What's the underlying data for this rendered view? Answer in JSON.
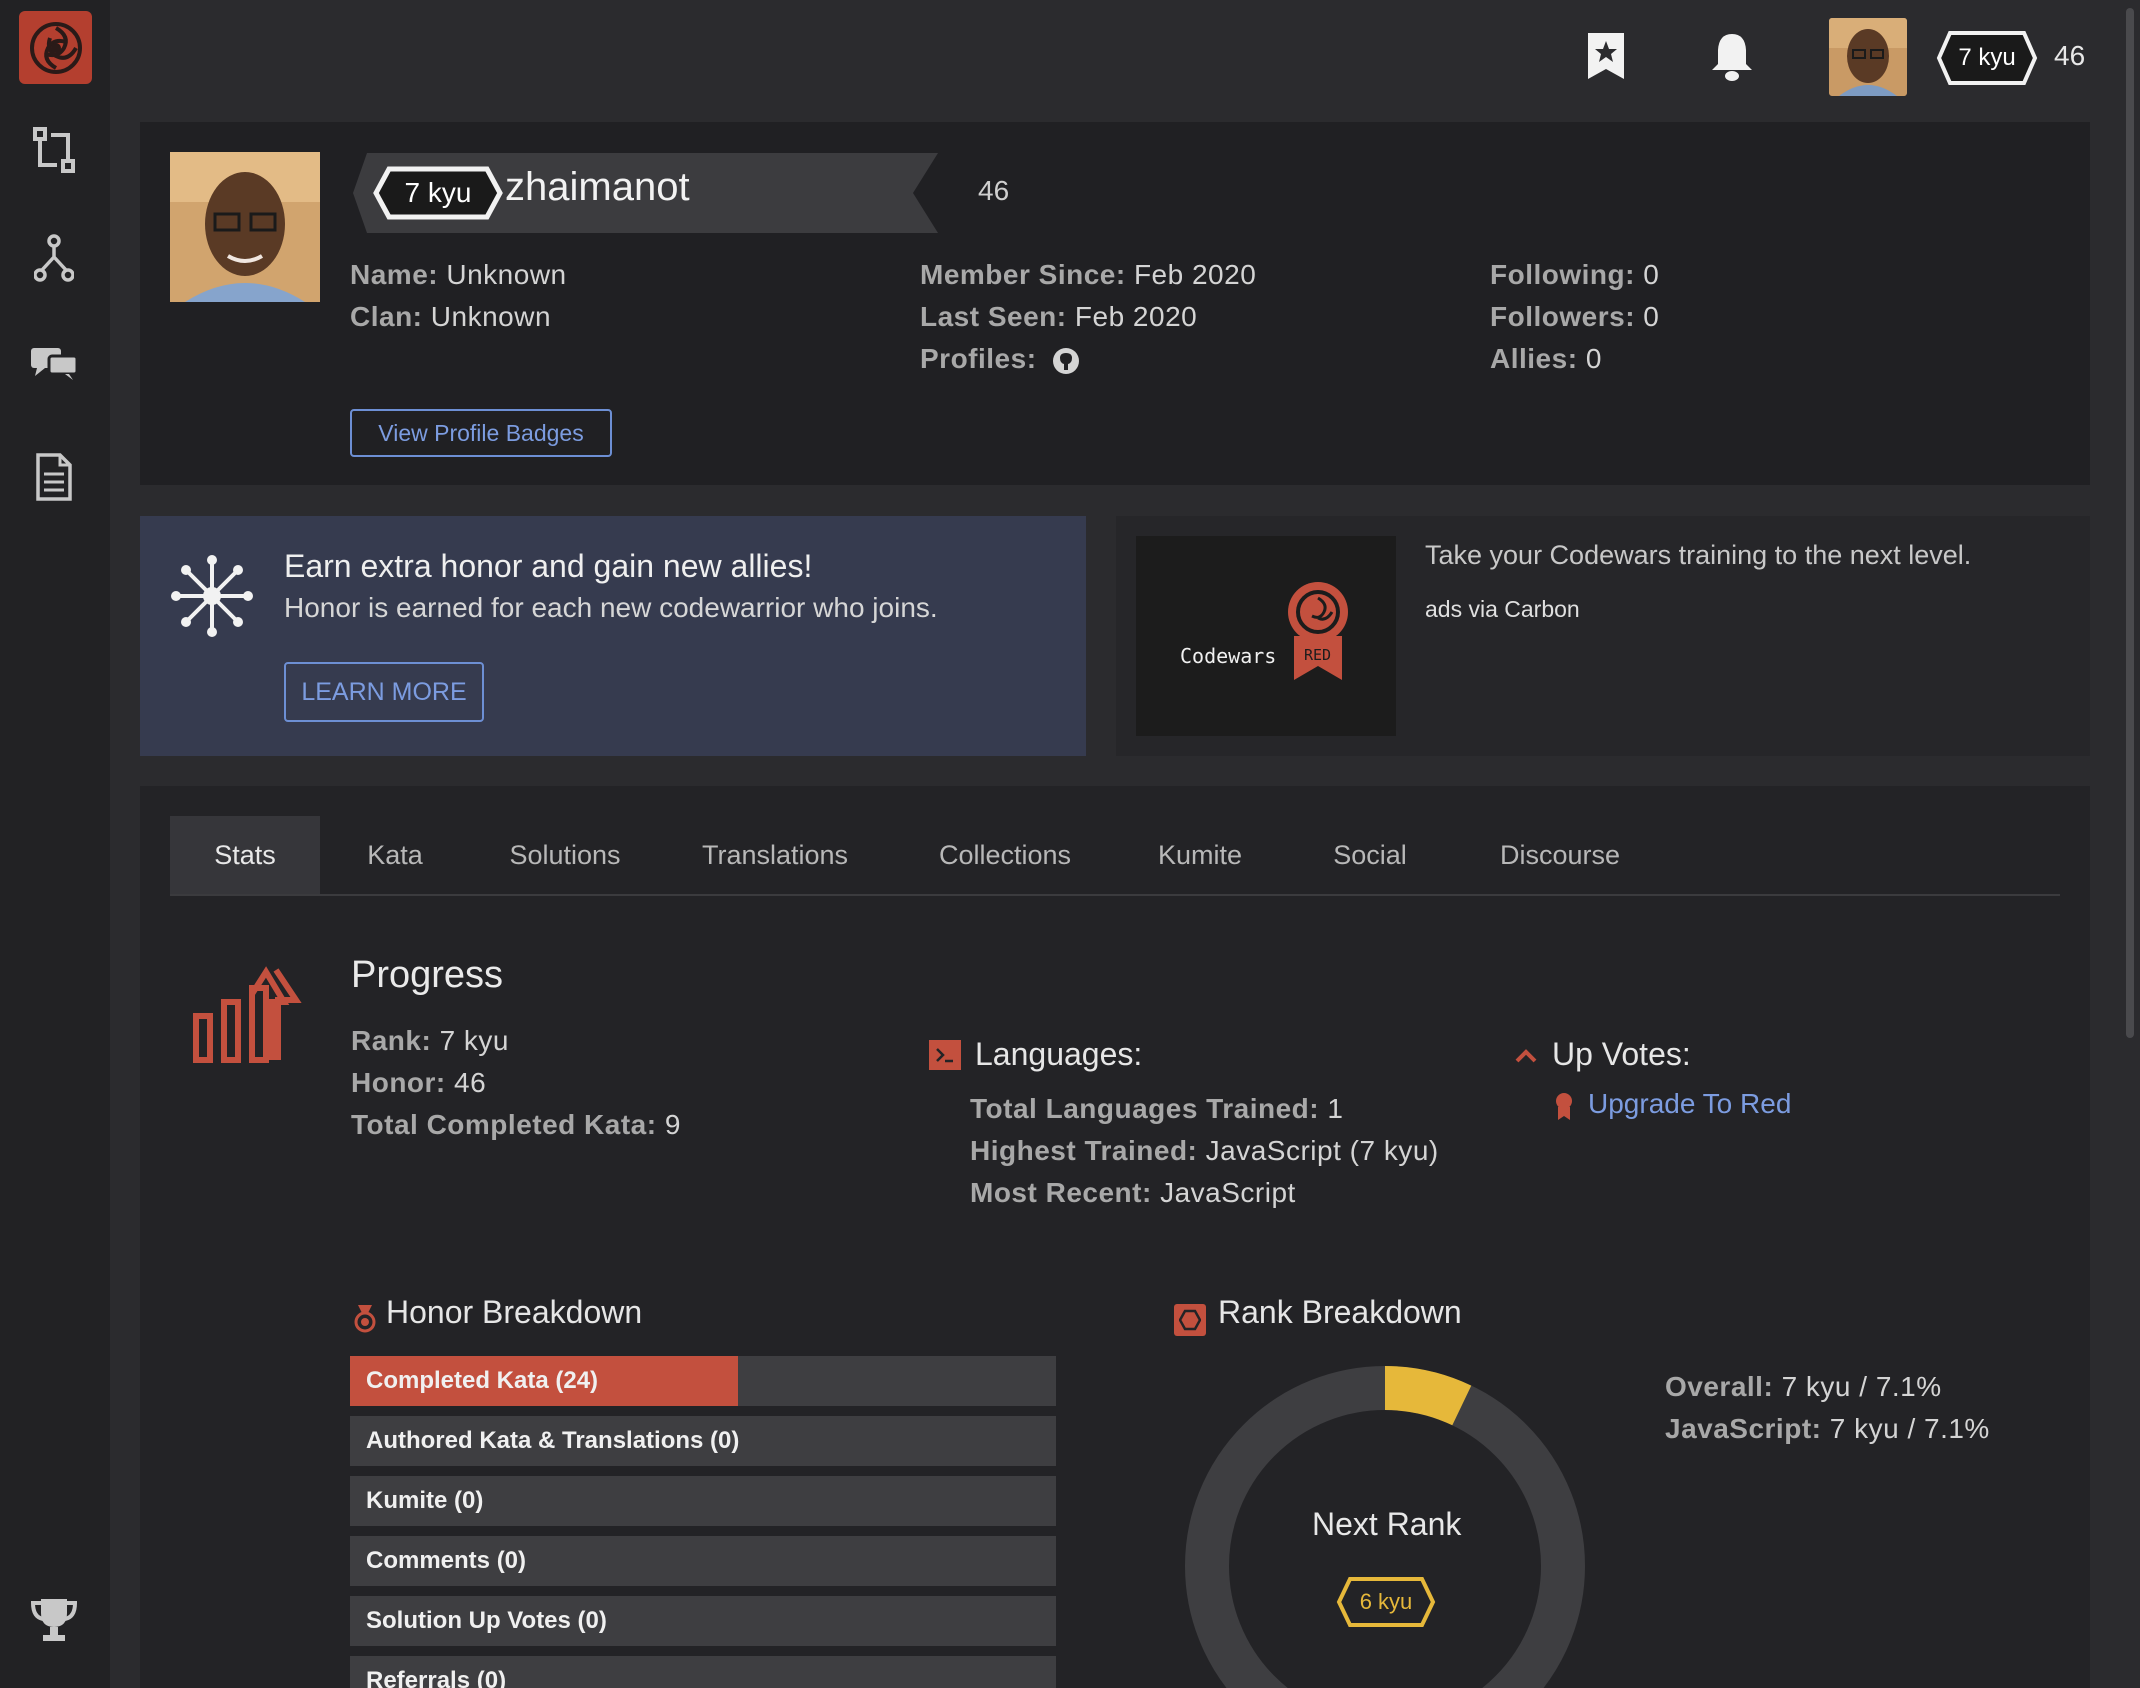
{
  "topbar": {
    "rank": "7 kyu",
    "honor": "46"
  },
  "profile": {
    "rank": "7 kyu",
    "username": "zhaimanot",
    "honor": "46",
    "name_label": "Name:",
    "name_value": "Unknown",
    "clan_label": "Clan:",
    "clan_value": "Unknown",
    "member_since_label": "Member Since:",
    "member_since_value": "Feb 2020",
    "last_seen_label": "Last Seen:",
    "last_seen_value": "Feb 2020",
    "profiles_label": "Profiles:",
    "following_label": "Following:",
    "following_value": "0",
    "followers_label": "Followers:",
    "followers_value": "0",
    "allies_label": "Allies:",
    "allies_value": "0",
    "badges_button": "View Profile Badges"
  },
  "promo": {
    "title": "Earn extra honor and gain new allies!",
    "subtitle": "Honor is earned for each new codewarrior who joins.",
    "button": "LEARN MORE"
  },
  "ad": {
    "brand": "Codewars",
    "badge": "RED",
    "text": "Take your Codewars training to the next level.",
    "via": "ads via Carbon"
  },
  "tabs": [
    "Stats",
    "Kata",
    "Solutions",
    "Translations",
    "Collections",
    "Kumite",
    "Social",
    "Discourse"
  ],
  "progress": {
    "title": "Progress",
    "rank_label": "Rank:",
    "rank_value": "7 kyu",
    "honor_label": "Honor:",
    "honor_value": "46",
    "completed_label": "Total Completed Kata:",
    "completed_value": "9"
  },
  "languages": {
    "title": "Languages:",
    "total_label": "Total Languages Trained:",
    "total_value": "1",
    "highest_label": "Highest Trained:",
    "highest_value": "JavaScript (7 kyu)",
    "recent_label": "Most Recent:",
    "recent_value": "JavaScript"
  },
  "upvotes": {
    "title": "Up Votes:",
    "link": "Upgrade To Red"
  },
  "honor_breakdown": {
    "title": "Honor Breakdown",
    "rows": [
      {
        "label": "Completed Kata (24)",
        "fill": 0.55
      },
      {
        "label": "Authored Kata & Translations (0)",
        "fill": 0
      },
      {
        "label": "Kumite (0)",
        "fill": 0
      },
      {
        "label": "Comments (0)",
        "fill": 0
      },
      {
        "label": "Solution Up Votes (0)",
        "fill": 0
      },
      {
        "label": "Referrals (0)",
        "fill": 0
      }
    ]
  },
  "rank_breakdown": {
    "title": "Rank Breakdown",
    "center_label": "Next Rank",
    "next_rank": "6 kyu",
    "progress": 0.071,
    "overall_label": "Overall:",
    "overall_value": "7 kyu / 7.1%",
    "js_label": "JavaScript:",
    "js_value": "7 kyu / 7.1%"
  },
  "colors": {
    "accent_red": "#b43f2f",
    "link_blue": "#7c9ce0",
    "rank_yellow": "#e6b83a"
  }
}
